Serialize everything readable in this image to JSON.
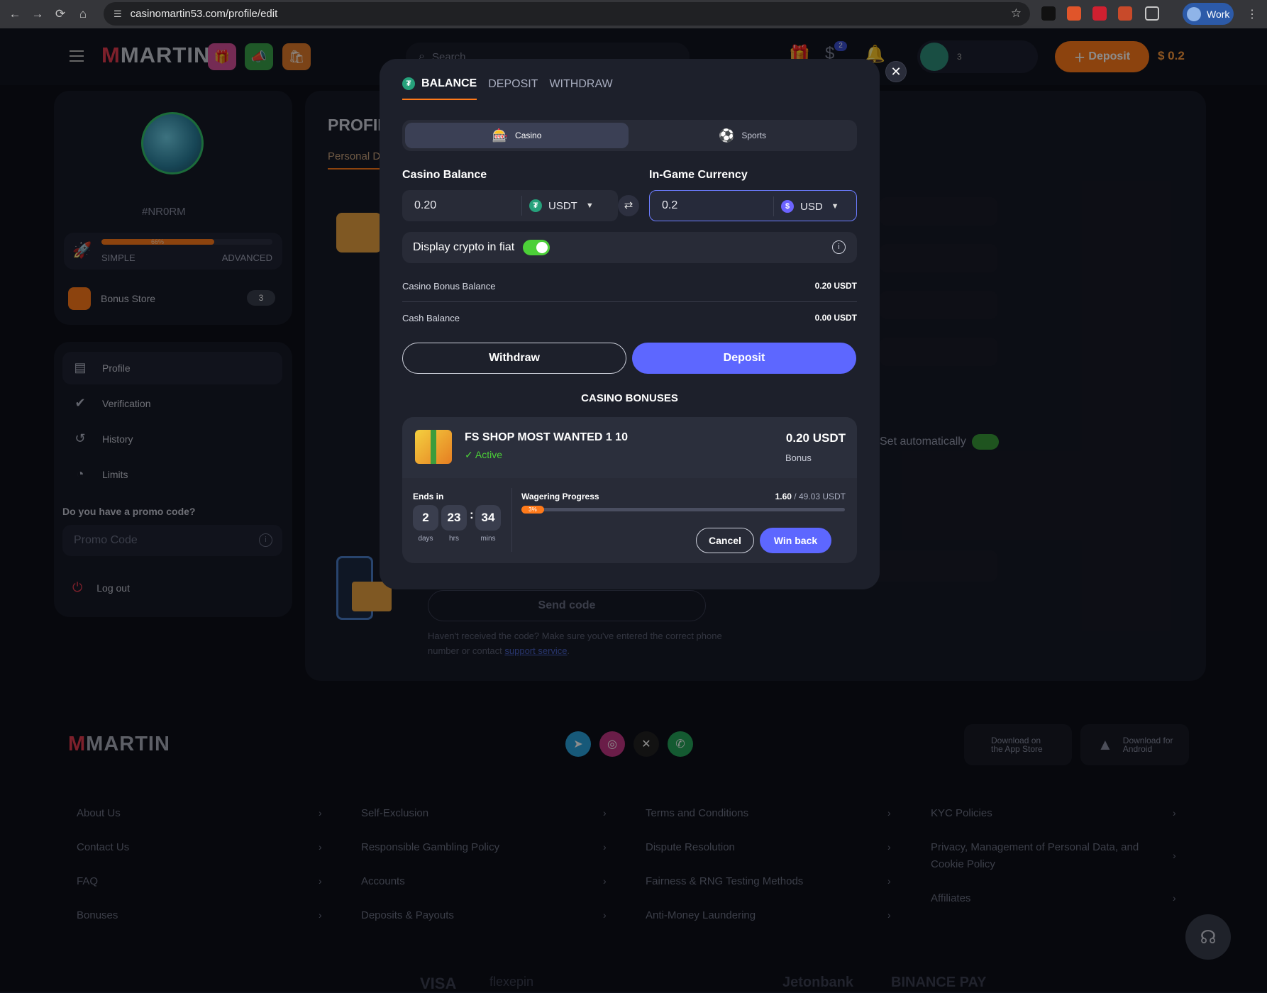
{
  "browser": {
    "url": "casinomartin53.com/profile/edit",
    "profile_label": "Work"
  },
  "header": {
    "logo": "MARTIN",
    "search_placeholder": "Search",
    "notif_count": "2",
    "user_coins": "3",
    "deposit_label": "Deposit",
    "balance": "$ 0.2"
  },
  "sidebar": {
    "user_id": "#NR0RM",
    "level_percent": 66,
    "level_percent_text": "66%",
    "level_left": "SIMPLE",
    "level_right": "ADVANCED",
    "bonus_store": "Bonus Store",
    "bonus_store_count": "3",
    "menu": [
      "Profile",
      "Verification",
      "History",
      "Limits"
    ],
    "promo_question": "Do you have a promo code?",
    "promo_placeholder": "Promo Code",
    "logout": "Log out"
  },
  "profile_page": {
    "title": "PROFIL",
    "tab": "Personal D",
    "set_auto": "Set automatically",
    "send_code": "Send code",
    "help_text": "Haven't received the code? Make sure you've entered the correct phone number or contact ",
    "help_link": "support service",
    "help_end": "."
  },
  "modal": {
    "tabs": [
      "BALANCE",
      "DEPOSIT",
      "WITHDRAW"
    ],
    "segments": [
      "Casino",
      "Sports"
    ],
    "casino_balance_label": "Casino Balance",
    "casino_balance_value": "0.20",
    "casino_currency": "USDT",
    "ingame_label": "In-Game Currency",
    "ingame_value": "0.2",
    "ingame_currency": "USD",
    "fiat_label": "Display crypto in fiat",
    "rows": [
      {
        "label": "Casino Bonus Balance",
        "value": "0.20 USDT"
      },
      {
        "label": "Cash Balance",
        "value": "0.00 USDT"
      }
    ],
    "withdraw_btn": "Withdraw",
    "deposit_btn": "Deposit",
    "bonuses_title": "CASINO BONUSES",
    "bonus": {
      "name": "FS SHOP MOST WANTED 1 10",
      "status": "Active",
      "amount": "0.20 USDT",
      "amount_label": "Bonus",
      "ends_in": "Ends in",
      "days": "2",
      "hours": "23",
      "mins": "34",
      "days_label": "days",
      "hours_label": "hrs",
      "mins_label": "mins",
      "wagering_label": "Wagering Progress",
      "wagering_done": "1.60",
      "wagering_total": " / 49.03 USDT",
      "wagering_pct": 3,
      "wagering_pct_text": "3%",
      "cancel": "Cancel",
      "win_back": "Win back"
    }
  },
  "footer": {
    "logo": "MARTIN",
    "app_store": "Download on the App Store",
    "android": "Download for Android",
    "col1": [
      "About Us",
      "Contact Us",
      "FAQ",
      "Bonuses"
    ],
    "col2": [
      "Self-Exclusion",
      "Responsible Gambling Policy",
      "Accounts",
      "Deposits & Payouts"
    ],
    "col3": [
      "Terms and Conditions",
      "Dispute Resolution",
      "Fairness & RNG Testing Methods",
      "Anti-Money Laundering"
    ],
    "col4": [
      "KYC Policies",
      "Privacy, Management of Personal Data, and Cookie Policy",
      "Affiliates"
    ],
    "payments": [
      "VISA",
      "flexepin",
      "Jetonbank",
      "BINANCE PAY"
    ]
  },
  "colors": {
    "accent_orange": "#ff7a1a",
    "primary_blue": "#5d67ff",
    "active_green": "#4cd038"
  }
}
